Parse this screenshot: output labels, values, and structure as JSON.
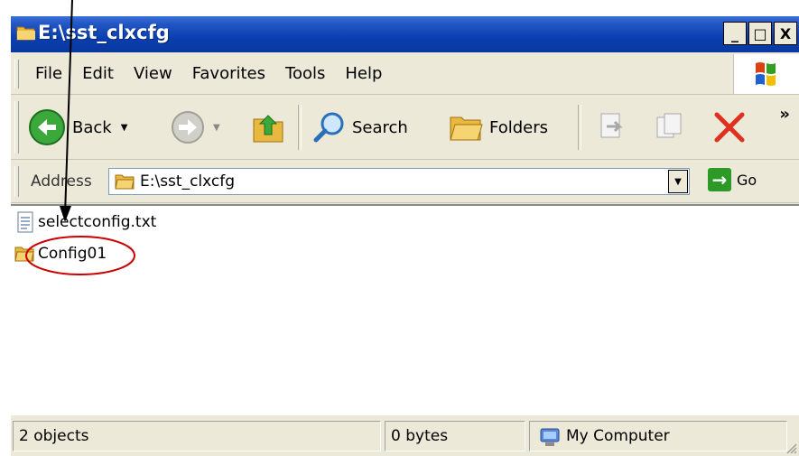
{
  "window": {
    "title": "E:\\sst_clxcfg"
  },
  "caption_buttons": {
    "minimize": "_",
    "maximize": "□",
    "close": "X"
  },
  "menu": {
    "items": [
      "File",
      "Edit",
      "View",
      "Favorites",
      "Tools",
      "Help"
    ]
  },
  "toolbar": {
    "back_label": "Back",
    "search_label": "Search",
    "folders_label": "Folders",
    "more_chevron": "»"
  },
  "address": {
    "label": "Address",
    "value": "E:\\sst_clxcfg",
    "go_label": "Go"
  },
  "files": [
    {
      "name": "selectconfig.txt",
      "type": "text-file-icon"
    },
    {
      "name": "Config01",
      "type": "folder-icon"
    }
  ],
  "status": {
    "objects": "2 objects",
    "size": "0 bytes",
    "zone": "My Computer"
  },
  "colors": {
    "titlebar": "#0a3fb0",
    "annotation": "#cc0000",
    "window_bg": "#ece9d8"
  }
}
